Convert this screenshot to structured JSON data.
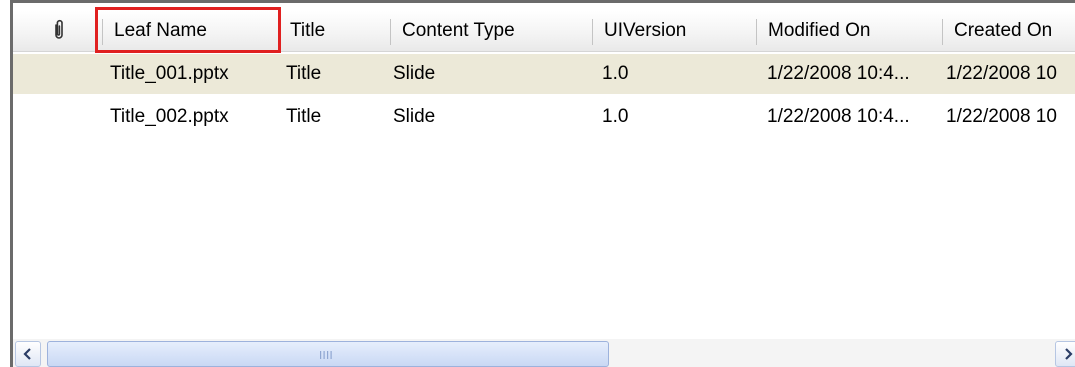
{
  "list": {
    "columns": [
      {
        "label": ""
      },
      {
        "label": "Leaf Name"
      },
      {
        "label": "Title"
      },
      {
        "label": "Content Type"
      },
      {
        "label": "UIVersion"
      },
      {
        "label": "Modified On"
      },
      {
        "label": "Created On"
      }
    ],
    "rows": [
      {
        "leaf_name": "Title_001.pptx",
        "title": "Title",
        "content_type": "Slide",
        "ui_version": "1.0",
        "modified_on": "1/22/2008 10:4...",
        "created_on": "1/22/2008 10"
      },
      {
        "leaf_name": "Title_002.pptx",
        "title": "Title",
        "content_type": "Slide",
        "ui_version": "1.0",
        "modified_on": "1/22/2008 10:4...",
        "created_on": "1/22/2008 10"
      }
    ]
  },
  "colors": {
    "selected_row": "#ece9d8",
    "highlight": "#e02020",
    "scroll_thumb": "#c9d8f4"
  },
  "icons": {
    "header_attachment": "paperclip-icon",
    "scroll_left": "chevron-left-icon",
    "scroll_right": "chevron-right-icon"
  }
}
